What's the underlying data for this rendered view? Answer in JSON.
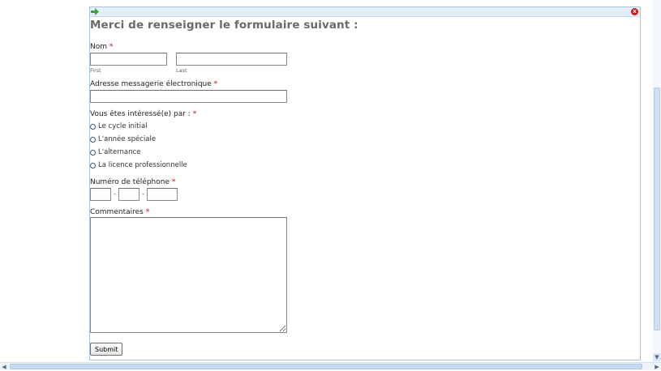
{
  "form": {
    "title": "Merci de renseigner le formulaire suivant :",
    "required_mark": "*",
    "name": {
      "label": "Nom",
      "first_sublabel": "First",
      "last_sublabel": "Last",
      "first_value": "",
      "last_value": ""
    },
    "email": {
      "label": "Adresse messagerie électronique",
      "value": ""
    },
    "interest": {
      "label": "Vous êtes intéressé(e) par :",
      "options": [
        "Le cycle initial",
        "L'année spéciale",
        "L'alternance",
        "La licence professionnelle"
      ]
    },
    "phone": {
      "label": "Numéro de téléphone",
      "separator": "-",
      "parts": [
        "",
        "",
        ""
      ]
    },
    "comments": {
      "label": "Commentaires",
      "value": ""
    },
    "submit_label": "Submit"
  },
  "icons": {
    "top_left": "green-arrow-icon",
    "top_right": "close-icon"
  },
  "colors": {
    "required": "#cc0000",
    "title": "#6a6a6a",
    "panel_border": "#a9c4dc",
    "arrow": "#3aa53a",
    "close": "#c21f1f"
  }
}
